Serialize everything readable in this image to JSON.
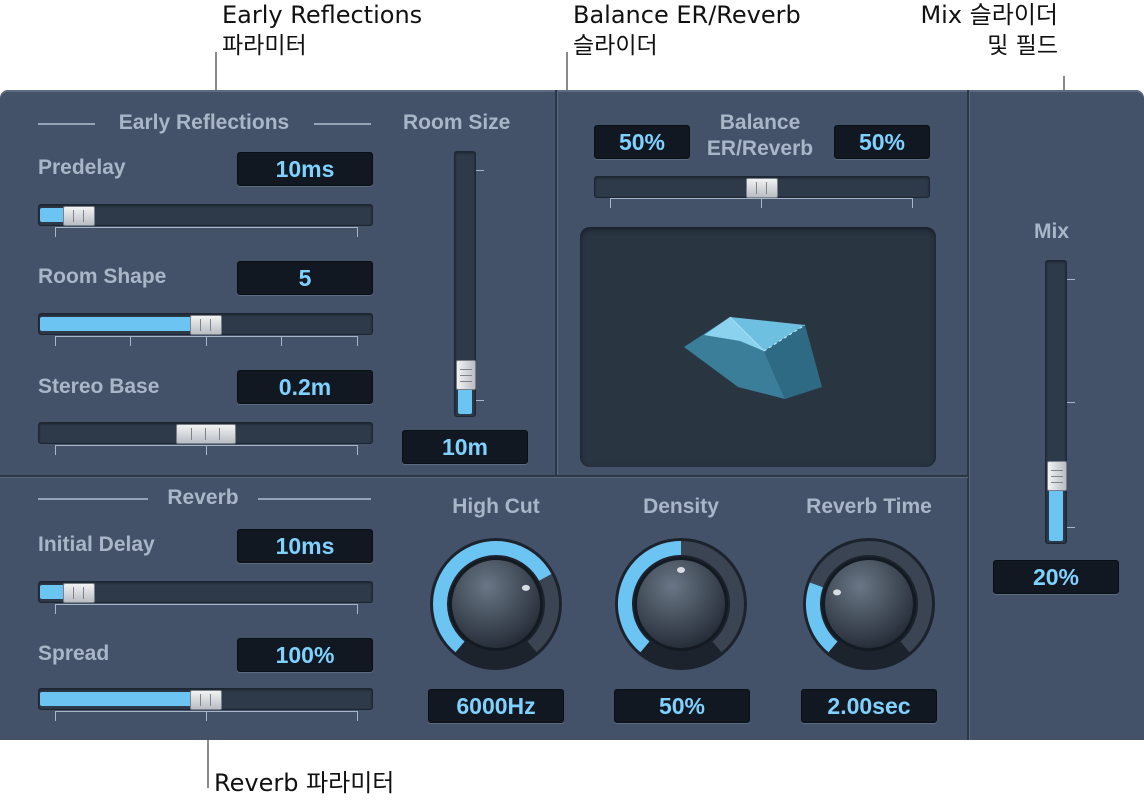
{
  "callouts": {
    "early_reflections": {
      "line1": "Early Reflections",
      "line2": "파라미터"
    },
    "balance": {
      "line1": "Balance ER/Reverb",
      "line2": "슬라이더"
    },
    "mix": {
      "line1": "Mix 슬라이더",
      "line2": "및 필드"
    },
    "reverb": {
      "line1": "Reverb 파라미터"
    }
  },
  "early_reflections": {
    "title": "Early Reflections",
    "predelay": {
      "label": "Predelay",
      "value": "10ms",
      "position": 0.08
    },
    "room_shape": {
      "label": "Room Shape",
      "value": "5",
      "position": 0.5
    },
    "stereo_base": {
      "label": "Stereo Base",
      "value": "0.2m",
      "position": 0.5
    }
  },
  "room_size": {
    "label": "Room Size",
    "value": "10m",
    "position": 0.1
  },
  "balance": {
    "label_line1": "Balance",
    "label_line2": "ER/Reverb",
    "left_value": "50%",
    "right_value": "50%",
    "position": 0.5
  },
  "mix": {
    "label": "Mix",
    "value": "20%",
    "position": 0.2
  },
  "reverb": {
    "title": "Reverb",
    "initial_delay": {
      "label": "Initial Delay",
      "value": "10ms",
      "position": 0.08
    },
    "spread": {
      "label": "Spread",
      "value": "100%",
      "position": 0.5
    }
  },
  "knobs": {
    "high_cut": {
      "label": "High Cut",
      "value": "6000Hz",
      "level": 0.72
    },
    "density": {
      "label": "Density",
      "value": "50%",
      "level": 0.5
    },
    "reverb_time": {
      "label": "Reverb Time",
      "value": "2.00sec",
      "level": 0.25
    }
  },
  "colors": {
    "panel": "#435268",
    "accent": "#6cc4f2",
    "field_text": "#7fd2ff",
    "label": "#a9b6c8"
  }
}
